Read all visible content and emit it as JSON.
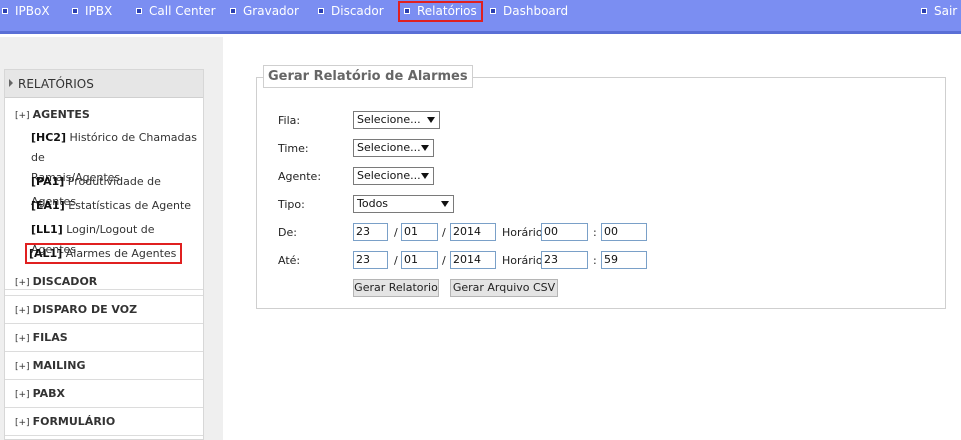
{
  "topnav": {
    "items": [
      "IPBoX",
      "IPBX",
      "Call Center",
      "Gravador",
      "Discador",
      "Relatórios",
      "Dashboard"
    ],
    "logout": "Sair"
  },
  "sidebar": {
    "header": "RELATÓRIOS",
    "sections": [
      {
        "toggle": "[+]",
        "label": "AGENTES"
      },
      {
        "toggle": "[+]",
        "label": "DISCADOR"
      },
      {
        "toggle": "[+]",
        "label": "DISPARO DE VOZ"
      },
      {
        "toggle": "[+]",
        "label": "FILAS"
      },
      {
        "toggle": "[+]",
        "label": "MAILING"
      },
      {
        "toggle": "[+]",
        "label": "PABX"
      },
      {
        "toggle": "[+]",
        "label": "FORMULÁRIO"
      }
    ],
    "agentes_items": [
      {
        "code": "[HC2]",
        "label": "Histórico de Chamadas de",
        "label2": "Ramais/Agentes"
      },
      {
        "code": "[PA1]",
        "label": "Produtividade de Agentes"
      },
      {
        "code": "[EA1]",
        "label": "Estatísticas de Agente"
      },
      {
        "code": "[LL1]",
        "label": "Login/Logout de Agentes"
      },
      {
        "code": "[AL1]",
        "label": "Alarmes de Agentes"
      }
    ]
  },
  "form": {
    "title": "Gerar Relatório de Alarmes",
    "fila_label": "Fila:",
    "fila_value": "Selecione...",
    "time_label": "Time:",
    "time_value": "Selecione...",
    "agente_label": "Agente:",
    "agente_value": "Selecione...",
    "tipo_label": "Tipo:",
    "tipo_value": "Todos",
    "de_label": "De:",
    "de": {
      "day": "23",
      "month": "01",
      "year": "2014",
      "hour": "00",
      "minute": "00"
    },
    "ate_label": "Até:",
    "ate": {
      "day": "23",
      "month": "01",
      "year": "2014",
      "hour": "23",
      "minute": "59"
    },
    "horario_label": "Horário",
    "date_sep": "/",
    "time_sep": ":",
    "btn_report": "Gerar Relatorio",
    "btn_csv": "Gerar Arquivo CSV"
  }
}
